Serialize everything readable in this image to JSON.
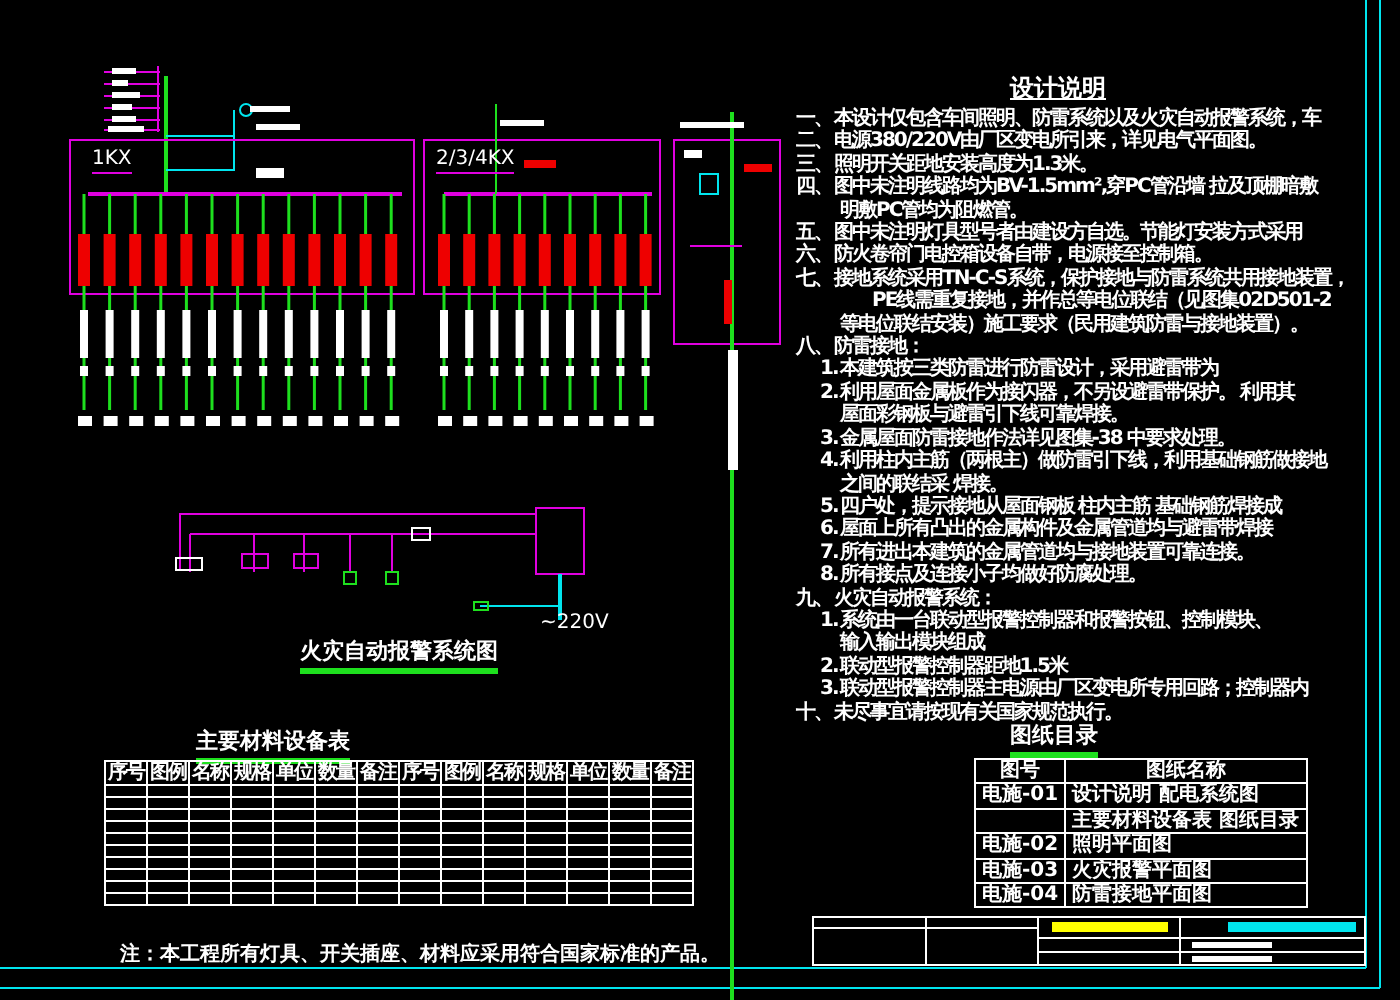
{
  "notes": {
    "title": "设计说明",
    "lines": [
      {
        "kind": "section",
        "label": "一、",
        "text": "本设计仅包含车间照明、防雷系统以及火灾自动报警系统，车"
      },
      {
        "kind": "section",
        "label": "二、",
        "text": "电源380/220V由厂区变电所引来，详见电气平面图。"
      },
      {
        "kind": "section",
        "label": "三、",
        "text": "照明开关距地安装高度为1.3米。"
      },
      {
        "kind": "section",
        "label": "四、",
        "text": "图中未注明线路均为BV-1.5mm²,穿PC管沿墙 拉及顶棚暗敷"
      },
      {
        "kind": "cont",
        "text": "明敷PC管均为阻燃管。"
      },
      {
        "kind": "section",
        "label": "五、",
        "text": "图中未注明灯具型号者由建设方自选。节能灯安装方式采用"
      },
      {
        "kind": "section",
        "label": "六、",
        "text": "防火卷帘门电控箱设备自带，电源接至控制箱。"
      },
      {
        "kind": "section",
        "label": "七、",
        "text": "接地系统采用TN-C-S系统，保护接地与防雷系统共用接地装置，"
      },
      {
        "kind": "cont2",
        "text": "PE线需重复接地，并作总等电位联结（见图集02D501-2"
      },
      {
        "kind": "cont",
        "text": "等电位联结安装）施工要求（民用建筑防雷与接地装置）。"
      },
      {
        "kind": "section",
        "label": "八、",
        "text": "防雷接地："
      },
      {
        "kind": "item",
        "label": "1.",
        "text": "本建筑按三类防雷进行防雷设计，采用避雷带为"
      },
      {
        "kind": "item",
        "label": "2.",
        "text": "利用屋面金属板作为接闪器，不另设避雷带保护。 利用其"
      },
      {
        "kind": "cont",
        "text": "屋面彩钢板与避雷引下线可靠焊接。"
      },
      {
        "kind": "item",
        "label": "3.",
        "text": "金属屋面防雷接地作法详见图集-38      中要求处理。"
      },
      {
        "kind": "item",
        "label": "4.",
        "text": "利用柱内主筋（两根主）做防雷引下线，利用基础钢筋做接地"
      },
      {
        "kind": "cont",
        "text": "之间的联结采   焊接。"
      },
      {
        "kind": "item",
        "label": "5.",
        "text": "四户处，提示接地从屋面钢板 柱内主筋 基础钢筋焊接成"
      },
      {
        "kind": "item",
        "label": "6.",
        "text": "屋面上所有凸出的金属构件及金属管道均与避雷带焊接"
      },
      {
        "kind": "item",
        "label": "7.",
        "text": "所有进出本建筑的金属管道均与接地装置可靠连接。"
      },
      {
        "kind": "item",
        "label": "8.",
        "text": "所有接点及连接小子均做好防腐处理。"
      },
      {
        "kind": "section",
        "label": "九、",
        "text": "火灾自动报警系统："
      },
      {
        "kind": "item",
        "label": "1.",
        "text": "系统由一台联动型报警控制器和报警按钮、控制模块、"
      },
      {
        "kind": "cont",
        "text": "输入输出模块组成"
      },
      {
        "kind": "item",
        "label": "2.",
        "text": "联动型报警控制器距地1.5米"
      },
      {
        "kind": "item",
        "label": "3.",
        "text": "联动型报警控制器主电源由厂区变电所专用回路；控制器内"
      },
      {
        "kind": "section",
        "label": "十、",
        "text": "未尽事宜请按现有关国家规范执行。"
      }
    ]
  },
  "panels": [
    {
      "label": "1KX"
    },
    {
      "label": "2/3/4KX"
    }
  ],
  "fire_alarm": {
    "title": "火灾自动报警系统图",
    "supply": "~220V"
  },
  "materials": {
    "title": "主要材料设备表",
    "columns": [
      "序号",
      "图例",
      "名称",
      "规格",
      "单位",
      "数量",
      "备注",
      "序号",
      "图例",
      "名称",
      "规格",
      "单位",
      "数量",
      "备注"
    ],
    "note": "注：本工程所有灯具、开关插座、材料应采用符合国家标准的产品。"
  },
  "drawing_list": {
    "title": "图纸目录",
    "columns": [
      "图号",
      "图纸名称"
    ],
    "rows": [
      {
        "number": "电施-01",
        "name": "设计说明 配电系统图"
      },
      {
        "number": "",
        "name": "主要材料设备表 图纸目录"
      },
      {
        "number": "电施-02",
        "name": "照明平面图"
      },
      {
        "number": "电施-03",
        "name": "火灾报警平面图"
      },
      {
        "number": "电施-04",
        "name": "防雷接地平面图"
      }
    ]
  }
}
